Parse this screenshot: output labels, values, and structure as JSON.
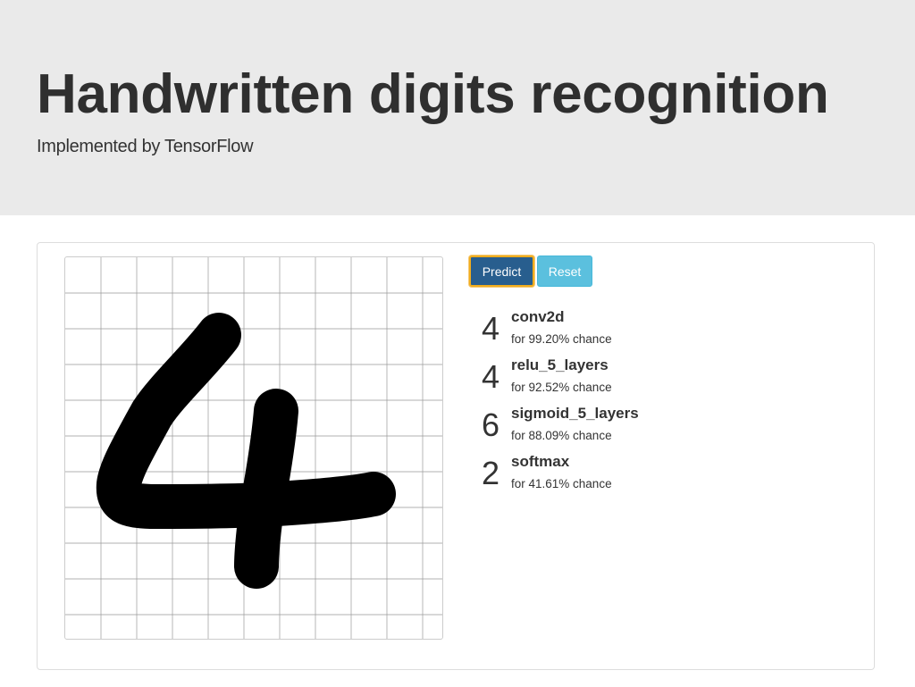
{
  "header": {
    "title": "Handwritten digits recognition",
    "subtitle": "Implemented by TensorFlow"
  },
  "controls": {
    "predict_label": "Predict",
    "reset_label": "Reset"
  },
  "drawing": {
    "drawn_digit": "4",
    "grid_cells": 10
  },
  "results": [
    {
      "digit": "4",
      "model": "conv2d",
      "chance_text": "for 99.20% chance"
    },
    {
      "digit": "4",
      "model": "relu_5_layers",
      "chance_text": "for 92.52% chance"
    },
    {
      "digit": "6",
      "model": "sigmoid_5_layers",
      "chance_text": "for 88.09% chance"
    },
    {
      "digit": "2",
      "model": "softmax",
      "chance_text": "for 41.61% chance"
    }
  ],
  "colors": {
    "header_bg": "#eaeaea",
    "predict_button": "#285e8e",
    "predict_focus_ring": "#f0ad1e",
    "reset_button": "#5bc0de",
    "stroke": "#000000",
    "grid": "#999999"
  }
}
